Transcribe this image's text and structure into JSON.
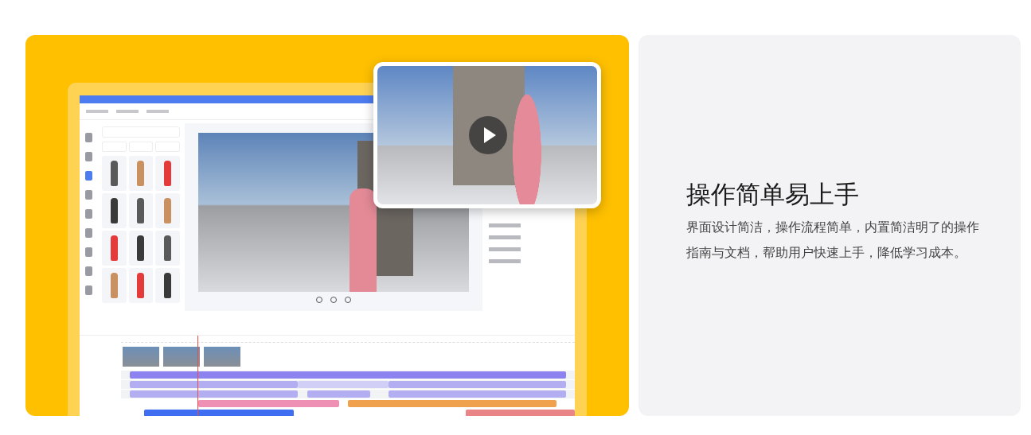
{
  "feature": {
    "title": "操作简单易上手",
    "description": "界面设计简洁，操作流程简单，内置简洁明了的操作指南与文档，帮助用户快速上手，降低学习成本。"
  }
}
